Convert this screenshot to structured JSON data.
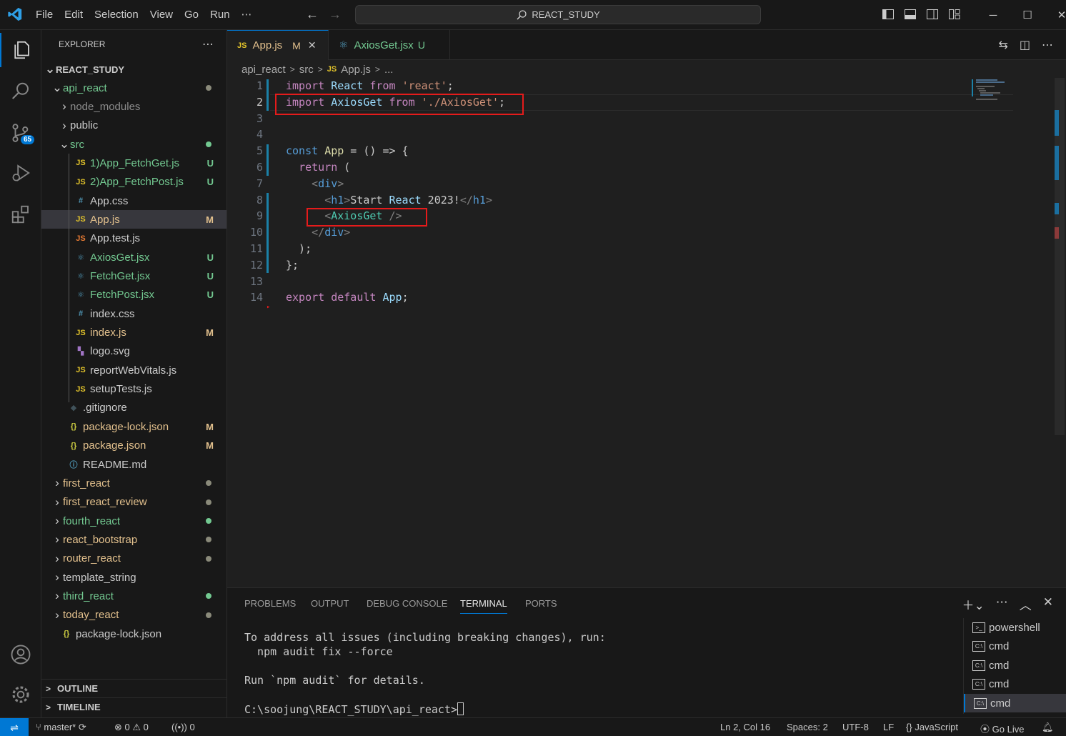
{
  "menu": [
    "File",
    "Edit",
    "Selection",
    "View",
    "Go",
    "Run",
    "⋯"
  ],
  "command_center": "REACT_STUDY",
  "activity": {
    "scm_badge": "65"
  },
  "explorer": {
    "title": "EXPLORER",
    "root": "REACT_STUDY",
    "rows": [
      {
        "label": "api_react",
        "chev": "v",
        "color": "#73c991",
        "dot": "#8a8a7a"
      },
      {
        "label": "node_modules",
        "chev": ">",
        "color": "#8c8c8c"
      },
      {
        "label": "public",
        "chev": ">",
        "color": "#cccccc"
      },
      {
        "label": "src",
        "chev": "v",
        "color": "#73c991",
        "dot": "#73c991"
      },
      {
        "label": "1)App_FetchGet.js",
        "icon": "JS",
        "iconColor": "#e2c32b",
        "color": "#73c991",
        "stat": "U",
        "statColor": "#73c991"
      },
      {
        "label": "2)App_FetchPost.js",
        "icon": "JS",
        "iconColor": "#e2c32b",
        "color": "#73c991",
        "stat": "U",
        "statColor": "#73c991"
      },
      {
        "label": "App.css",
        "icon": "#",
        "iconColor": "#519aba",
        "color": "#cccccc"
      },
      {
        "label": "App.js",
        "icon": "JS",
        "iconColor": "#e2c32b",
        "color": "#e2c08d",
        "stat": "M",
        "statColor": "#e2c08d",
        "selected": true
      },
      {
        "label": "App.test.js",
        "icon": "JS",
        "iconColor": "#e37933",
        "color": "#cccccc"
      },
      {
        "label": "AxiosGet.jsx",
        "icon": "⚛",
        "iconColor": "#519aba",
        "color": "#73c991",
        "stat": "U",
        "statColor": "#73c991"
      },
      {
        "label": "FetchGet.jsx",
        "icon": "⚛",
        "iconColor": "#519aba",
        "color": "#73c991",
        "stat": "U",
        "statColor": "#73c991"
      },
      {
        "label": "FetchPost.jsx",
        "icon": "⚛",
        "iconColor": "#519aba",
        "color": "#73c991",
        "stat": "U",
        "statColor": "#73c991"
      },
      {
        "label": "index.css",
        "icon": "#",
        "iconColor": "#519aba",
        "color": "#cccccc"
      },
      {
        "label": "index.js",
        "icon": "JS",
        "iconColor": "#e2c32b",
        "color": "#e2c08d",
        "stat": "M",
        "statColor": "#e2c08d"
      },
      {
        "label": "logo.svg",
        "icon": "▚",
        "iconColor": "#a074c4",
        "color": "#cccccc"
      },
      {
        "label": "reportWebVitals.js",
        "icon": "JS",
        "iconColor": "#e2c32b",
        "color": "#cccccc"
      },
      {
        "label": "setupTests.js",
        "icon": "JS",
        "iconColor": "#e2c32b",
        "color": "#cccccc"
      },
      {
        "label": ".gitignore",
        "icon": "◆",
        "iconColor": "#41535b",
        "color": "#cccccc"
      },
      {
        "label": "package-lock.json",
        "icon": "{}",
        "iconColor": "#cbcb41",
        "color": "#e2c08d",
        "stat": "M",
        "statColor": "#e2c08d"
      },
      {
        "label": "package.json",
        "icon": "{}",
        "iconColor": "#cbcb41",
        "color": "#e2c08d",
        "stat": "M",
        "statColor": "#e2c08d"
      },
      {
        "label": "README.md",
        "icon": "ⓘ",
        "iconColor": "#519aba",
        "color": "#cccccc"
      },
      {
        "label": "first_react",
        "chev": ">",
        "color": "#e2c08d",
        "dot": "#8a8a7a"
      },
      {
        "label": "first_react_review",
        "chev": ">",
        "color": "#e2c08d",
        "dot": "#8a8a7a"
      },
      {
        "label": "fourth_react",
        "chev": ">",
        "color": "#73c991",
        "dot": "#73c991"
      },
      {
        "label": "react_bootstrap",
        "chev": ">",
        "color": "#e2c08d",
        "dot": "#8a8a7a"
      },
      {
        "label": "router_react",
        "chev": ">",
        "color": "#e2c08d",
        "dot": "#8a8a7a"
      },
      {
        "label": "template_string",
        "chev": ">",
        "color": "#cccccc"
      },
      {
        "label": "third_react",
        "chev": ">",
        "color": "#73c991",
        "dot": "#73c991"
      },
      {
        "label": "today_react",
        "chev": ">",
        "color": "#e2c08d",
        "dot": "#8a8a7a"
      },
      {
        "label": "package-lock.json",
        "icon": "{}",
        "iconColor": "#cbcb41",
        "color": "#cccccc"
      }
    ],
    "outline": "OUTLINE",
    "timeline": "TIMELINE"
  },
  "tabs": [
    {
      "label": "App.js",
      "status": "M",
      "active": true
    },
    {
      "label": "AxiosGet.jsx",
      "status": "U",
      "active": false
    }
  ],
  "breadcrumb": [
    "api_react",
    "src",
    "App.js",
    "..."
  ],
  "code_lines": [
    "import React from 'react';",
    "import AxiosGet from './AxiosGet';",
    "",
    "",
    "const App = () => {",
    "  return (",
    "    <div>",
    "      <h1>Start React 2023!</h1>",
    "      <AxiosGet />",
    "    </div>",
    "  );",
    "};",
    "",
    "export default App;"
  ],
  "panel": {
    "tabs": [
      "PROBLEMS",
      "OUTPUT",
      "DEBUG CONSOLE",
      "TERMINAL",
      "PORTS"
    ],
    "active_tab": "TERMINAL",
    "terminal_lines": [
      "To address all issues (including breaking changes), run:",
      "  npm audit fix --force",
      "",
      "Run `npm audit` for details.",
      "",
      "C:\\soojung\\REACT_STUDY\\api_react>"
    ],
    "terminals": [
      "powershell",
      "cmd",
      "cmd",
      "cmd",
      "cmd"
    ]
  },
  "status": {
    "branch": "master*",
    "errors": "0",
    "warnings": "0",
    "ports": "0",
    "position": "Ln 2, Col 16",
    "spaces": "Spaces: 2",
    "encoding": "UTF-8",
    "eol": "LF",
    "language": "JavaScript",
    "golive": "Go Live"
  }
}
